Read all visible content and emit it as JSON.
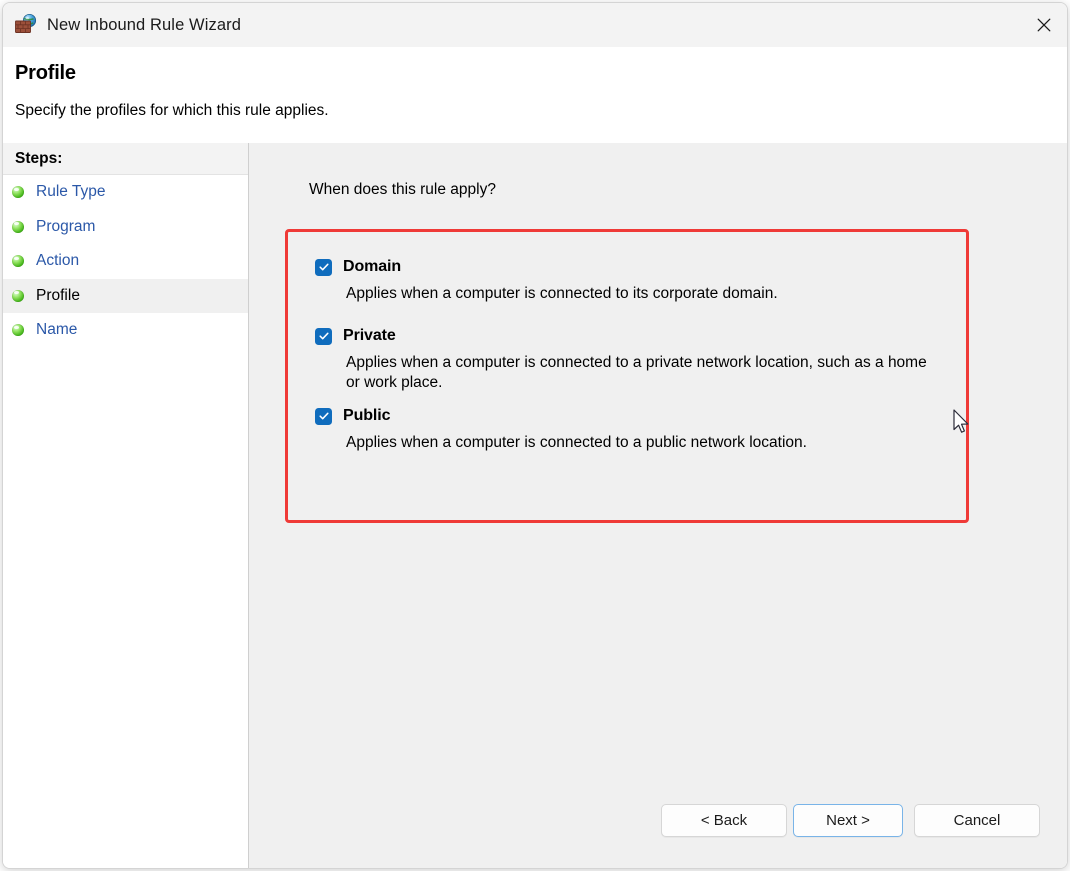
{
  "window": {
    "title": "New Inbound Rule Wizard",
    "title_icon": "firewall-globe-icon",
    "close_icon": "close-icon"
  },
  "header": {
    "title": "Profile",
    "subtitle": "Specify the profiles for which this rule applies."
  },
  "sidebar": {
    "heading": "Steps:",
    "items": [
      {
        "label": "Rule Type",
        "active": false
      },
      {
        "label": "Program",
        "active": false
      },
      {
        "label": "Action",
        "active": false
      },
      {
        "label": "Profile",
        "active": true
      },
      {
        "label": "Name",
        "active": false
      }
    ]
  },
  "content": {
    "question": "When does this rule apply?",
    "profiles": [
      {
        "name": "Domain",
        "checked": true,
        "description": "Applies when a computer is connected to its corporate domain."
      },
      {
        "name": "Private",
        "checked": true,
        "description": "Applies when a computer is connected to a private network location, such as a home or work place."
      },
      {
        "name": "Public",
        "checked": true,
        "description": "Applies when a computer is connected to a public network location."
      }
    ]
  },
  "footer": {
    "back_label": "< Back",
    "next_label": "Next >",
    "cancel_label": "Cancel"
  },
  "colors": {
    "accent_checkbox": "#0f6cbd",
    "annotation_highlight": "#ef3a37",
    "link_text": "#2b58a8",
    "titlebar_bg": "#f3f3f3",
    "content_bg": "#f0f0f0"
  }
}
